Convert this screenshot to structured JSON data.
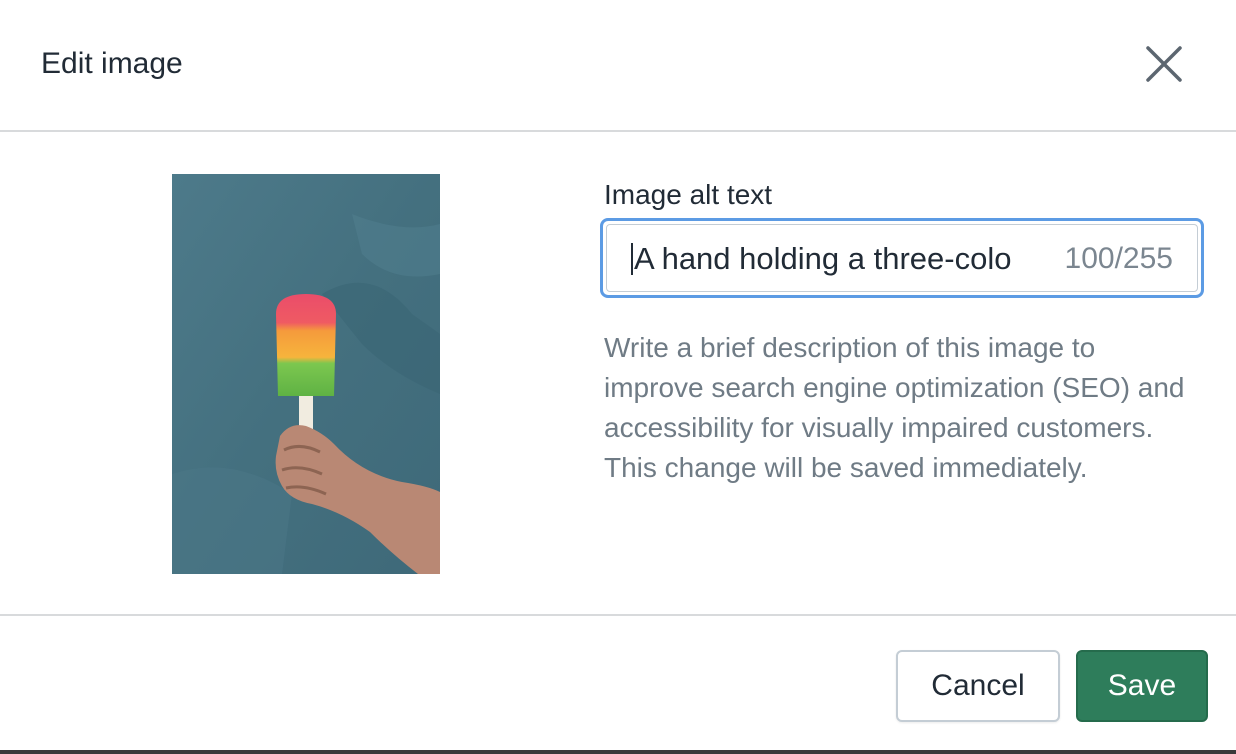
{
  "dialog": {
    "title": "Edit image",
    "close_icon": "close-icon"
  },
  "image": {
    "description": "popsicle-photo",
    "colors": {
      "background": "#46707f",
      "popsicle_top": "#e8455f",
      "popsicle_middle": "#f5a83a",
      "popsicle_bottom": "#6fc14a",
      "stick": "#f3efe3",
      "hand": "#c69580"
    }
  },
  "alt_text": {
    "label": "Image alt text",
    "value": "A hand holding a three-colo",
    "counter": "100/255",
    "help": "Write a brief description of this image to improve search engine optimization (SEO) and accessibility for visually impaired customers. This change will be saved immediately."
  },
  "footer": {
    "cancel_label": "Cancel",
    "save_label": "Save"
  },
  "colors": {
    "accent": "#2e7d5b",
    "focus_ring": "#5c9be4",
    "text": "#212b36",
    "subdued": "#6f7b85"
  }
}
